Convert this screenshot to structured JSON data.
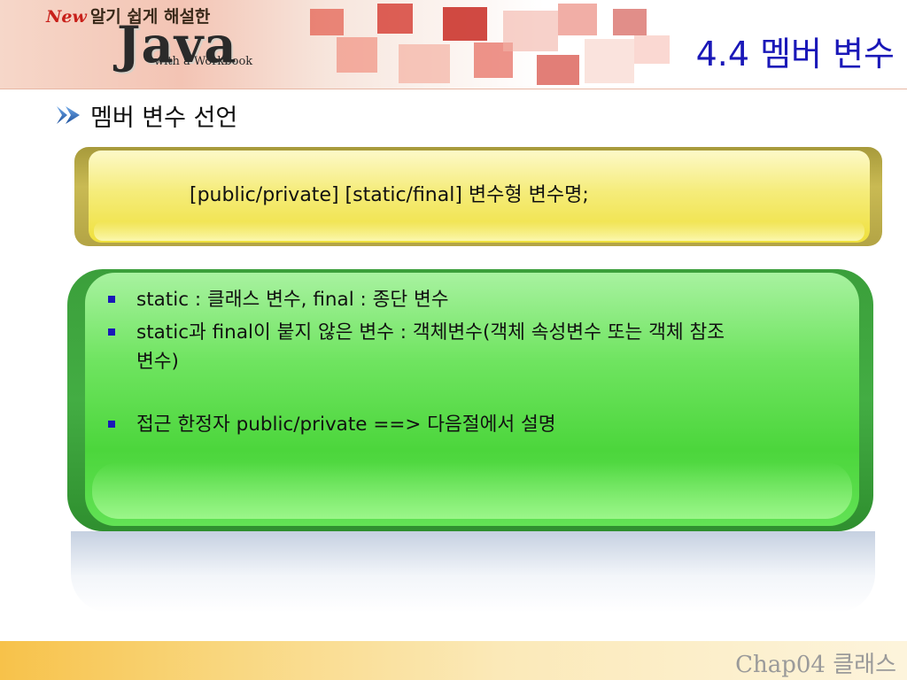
{
  "header": {
    "logo_new": "New",
    "logo_korean": "알기 쉽게 해설한",
    "logo_java": "Java",
    "logo_sub": "with a Workbook",
    "title": "4.4 멤버 변수"
  },
  "subheading": {
    "icon": "arrow-right-icon",
    "text": "멤버 변수 선언"
  },
  "syntax_box": {
    "text": "[public/private] [static/final] 변수형 변수명;"
  },
  "bullets": [
    {
      "text": "static : 클래스 변수, final : 종단 변수"
    },
    {
      "text": "static과 final이 붙지 않은 변수 : 객체변수(객체 속성변수 또는 객체 참조",
      "text_cont": "변수)"
    },
    {
      "text": "접근 한정자 public/private ==> 다음절에서 설명"
    }
  ],
  "footer": {
    "text": "Chap04 클래스"
  },
  "colors": {
    "title": "#1a18b8",
    "bullet": "#1a18b8",
    "syntax_box": "#f5ec7a",
    "bullet_box": "#4cd63c",
    "footer_text": "#9a9a9a"
  }
}
